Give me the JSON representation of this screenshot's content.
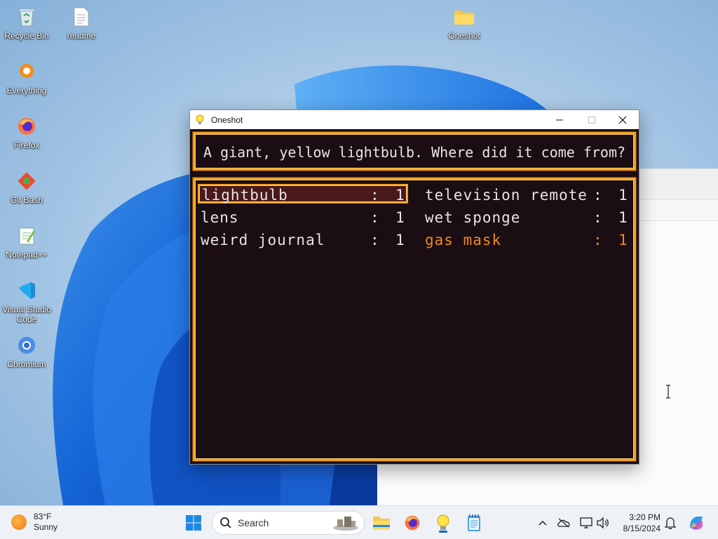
{
  "desktop": {
    "icons": [
      {
        "label": "Recycle Bin",
        "icon": "recycle-bin-icon"
      },
      {
        "label": "readme",
        "icon": "text-file-icon"
      },
      {
        "label": "Oneshot",
        "icon": "folder-icon"
      },
      {
        "label": "Everything",
        "icon": "everything-search-icon"
      },
      {
        "label": "Firefox",
        "icon": "firefox-icon"
      },
      {
        "label": "Git Bash",
        "icon": "git-bash-icon"
      },
      {
        "label": "Notepad++",
        "icon": "notepadpp-icon"
      },
      {
        "label": "Visual Studio Code",
        "icon": "vscode-icon"
      },
      {
        "label": "Chromium",
        "icon": "chromium-icon"
      }
    ]
  },
  "window": {
    "title": "Oneshot",
    "description": "A giant, yellow lightbulb. Where did it come from?",
    "inventory": [
      {
        "name": "lightbulb",
        "sep": ":",
        "qty": "1",
        "selected": true
      },
      {
        "name": "television remote",
        "sep": ":",
        "qty": "1"
      },
      {
        "name": "lens",
        "sep": ":",
        "qty": "1"
      },
      {
        "name": "wet sponge",
        "sep": ":",
        "qty": "1"
      },
      {
        "name": "weird journal",
        "sep": ":",
        "qty": "1"
      },
      {
        "name": "gas mask",
        "sep": ":",
        "qty": "1",
        "highlight": true
      }
    ],
    "colors": {
      "frame": "#f0a020",
      "background": "#1a0d13",
      "text": "#e8e4e6",
      "highlight": "#f08a1c"
    }
  },
  "taskbar": {
    "weather": {
      "temp": "83°F",
      "condition": "Sunny"
    },
    "search_label": "Search",
    "clock": {
      "time": "3:20 PM",
      "date": "8/15/2024"
    }
  }
}
